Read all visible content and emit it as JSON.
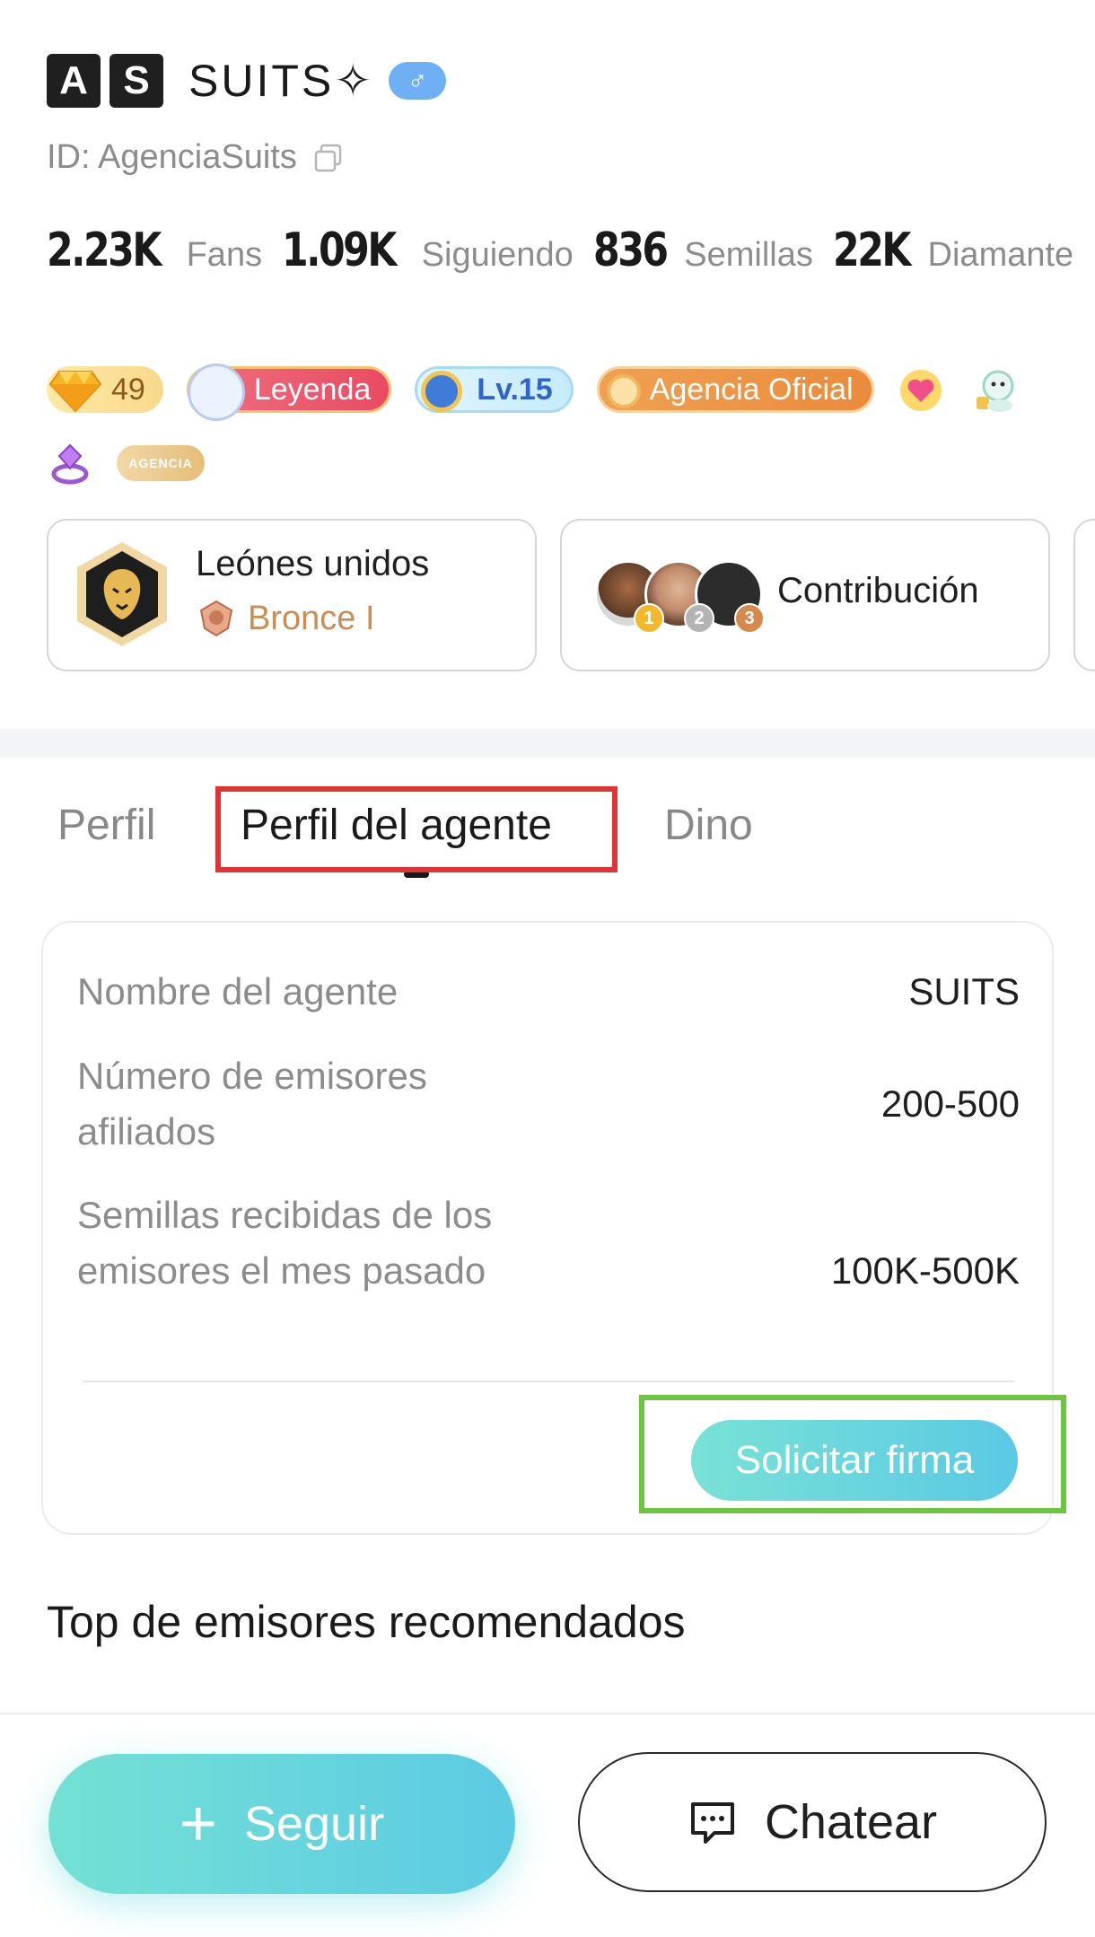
{
  "profile": {
    "initials": [
      "A",
      "S"
    ],
    "username": "SUITS✧",
    "gender_symbol": "♂",
    "id_text": "ID: AgenciaSuits"
  },
  "stats": [
    {
      "value": "2.23K",
      "label": "Fans"
    },
    {
      "value": "1.09K",
      "label": "Siguiendo"
    },
    {
      "value": "836",
      "label": "Semillas"
    },
    {
      "value": "22K",
      "label": "Diamante"
    }
  ],
  "badges": {
    "gem_count": "49",
    "leyenda": "Leyenda",
    "level": "Lv.15",
    "agency": "Agencia Oficial",
    "agency_small": "AGENCIA"
  },
  "cards": {
    "club_name": "Leónes unidos",
    "club_rank": "Bronce I",
    "contribution": "Contribución",
    "ranks": [
      "1",
      "2",
      "3"
    ]
  },
  "tabs": {
    "perfil": "Perfil",
    "agente": "Perfil del agente",
    "dino": "Dino"
  },
  "agent_info": {
    "rows": [
      {
        "label": "Nombre del agente",
        "value": "SUITS"
      },
      {
        "label": "Número de emisores afiliados",
        "value": "200-500"
      },
      {
        "label": "Semillas recibidas de los emisores el mes pasado",
        "value": "100K-500K"
      }
    ],
    "request_button": "Solicitar firma"
  },
  "section_title": "Top de emisores recomendados",
  "actions": {
    "follow": "Seguir",
    "follow_symbol": "+",
    "chat": "Chatear"
  },
  "colors": {
    "accent_start": "#74e1d4",
    "accent_end": "#5ccbe3",
    "highlight_red": "#e03434",
    "highlight_green": "#6cc63f"
  }
}
